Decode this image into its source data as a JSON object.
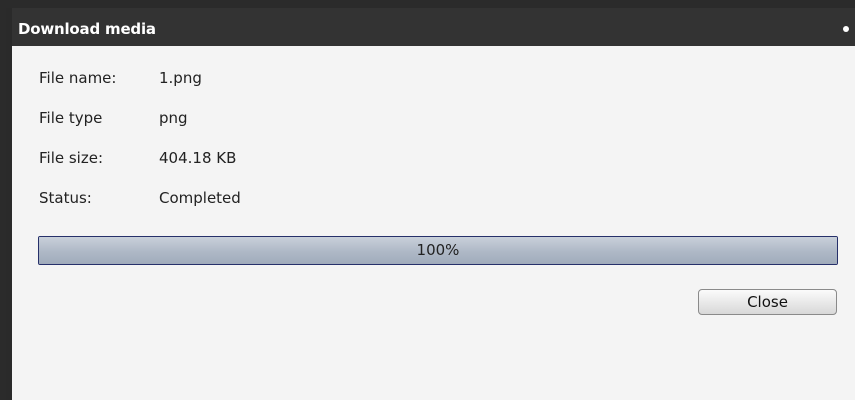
{
  "dialog": {
    "title": "Download media"
  },
  "fields": {
    "file_name": {
      "label": "File name:",
      "value": "1.png"
    },
    "file_type": {
      "label": "File type",
      "value": "png"
    },
    "file_size": {
      "label": "File size:",
      "value": "404.18 KB"
    },
    "status": {
      "label": "Status:",
      "value": "Completed"
    }
  },
  "progress": {
    "percent": 100,
    "label": "100%"
  },
  "buttons": {
    "close_label": "Close"
  },
  "colors": {
    "titlebar": "#333333",
    "dialog_background": "#f4f4f4",
    "progress_border": "#26306a"
  }
}
